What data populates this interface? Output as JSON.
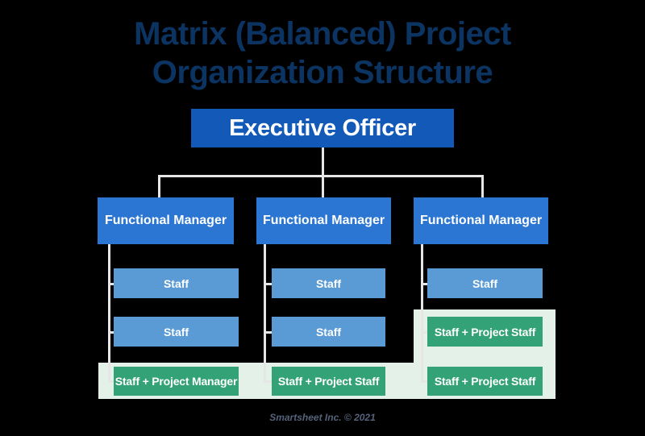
{
  "title": {
    "line1": "Matrix (Balanced) Project",
    "line2": "Organization Structure"
  },
  "executive": {
    "label": "Executive Officer"
  },
  "columns": [
    {
      "manager": "Functional Manager",
      "rows": [
        {
          "label": "Staff",
          "kind": "staff"
        },
        {
          "label": "Staff",
          "kind": "staff"
        },
        {
          "label": "Staff + Project Manager",
          "kind": "project"
        }
      ]
    },
    {
      "manager": "Functional Manager",
      "rows": [
        {
          "label": "Staff",
          "kind": "staff"
        },
        {
          "label": "Staff",
          "kind": "staff"
        },
        {
          "label": "Staff + Project Staff",
          "kind": "project"
        }
      ]
    },
    {
      "manager": "Functional Manager",
      "rows": [
        {
          "label": "Staff",
          "kind": "staff"
        },
        {
          "label": "Staff + Project Staff",
          "kind": "project"
        },
        {
          "label": "Staff + Project Staff",
          "kind": "project"
        }
      ]
    }
  ],
  "footer": {
    "credit": "Smartsheet Inc. © 2021"
  },
  "colors": {
    "background": "#000000",
    "title": "#0c3462",
    "executive_box": "#1259b8",
    "manager_box": "#2a76d2",
    "staff_box": "#5b9bd5",
    "project_box": "#33a276",
    "highlight_panel": "#e4f1e8",
    "connector": "#e6e6e6",
    "footer_text": "#55627a"
  }
}
